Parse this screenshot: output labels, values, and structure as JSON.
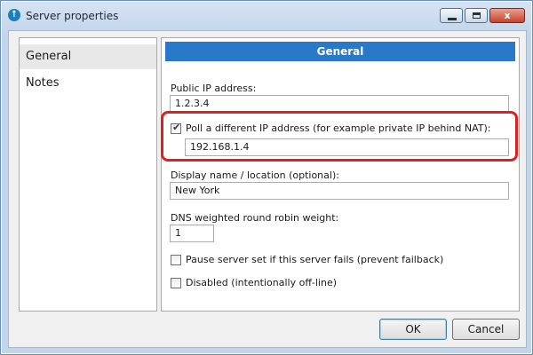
{
  "window": {
    "title": "Server properties"
  },
  "titlebar": {
    "close_label": "x"
  },
  "nav": {
    "items": [
      "General",
      "Notes"
    ],
    "selected": "General"
  },
  "panel": {
    "header": "General",
    "public_ip": {
      "label": "Public IP address:",
      "value": "1.2.3.4"
    },
    "poll_different": {
      "label": "Poll a different IP address (for example private IP behind NAT):",
      "checked": true,
      "value": "192.168.1.4"
    },
    "display_name": {
      "label": "Display name / location (optional):",
      "value": "New York"
    },
    "dns_weight": {
      "label": "DNS weighted round robin weight:",
      "value": "1"
    },
    "pause_server": {
      "label": "Pause server set if this server fails (prevent failback)",
      "checked": false
    },
    "disabled": {
      "label": "Disabled (intentionally off-line)",
      "checked": false
    }
  },
  "buttons": {
    "ok": "OK",
    "cancel": "Cancel"
  },
  "colors": {
    "header_bg": "#2a78c8",
    "highlight": "#e02020"
  }
}
